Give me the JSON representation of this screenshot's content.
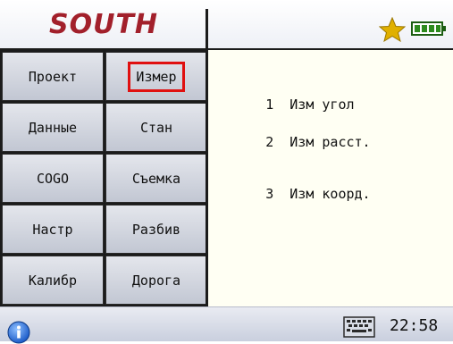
{
  "header": {
    "brand": "SOUTH",
    "icons": {
      "favorite": "star-icon",
      "battery": "battery-icon"
    },
    "colors": {
      "brand": "#a2202b",
      "star": "#e0b000",
      "battery": "#2d8a1e"
    }
  },
  "menu": {
    "items": [
      {
        "label": "Проект",
        "name": "menu-project"
      },
      {
        "label": "Измер",
        "name": "menu-measure",
        "selected": true
      },
      {
        "label": "Данные",
        "name": "menu-data"
      },
      {
        "label": "Стан",
        "name": "menu-station"
      },
      {
        "label": "COGO",
        "name": "menu-cogo"
      },
      {
        "label": "Съемка",
        "name": "menu-survey"
      },
      {
        "label": "Настр",
        "name": "menu-settings"
      },
      {
        "label": "Разбив",
        "name": "menu-stakeout"
      },
      {
        "label": "Калибр",
        "name": "menu-calibration"
      },
      {
        "label": "Дорога",
        "name": "menu-road"
      }
    ],
    "selected_color": "#e01010"
  },
  "submenu": {
    "items": [
      {
        "number": "1",
        "label": "Изм угол"
      },
      {
        "number": "2",
        "label": "Изм расст."
      },
      {
        "number": "3",
        "label": "Изм коорд."
      }
    ]
  },
  "statusbar": {
    "time": "22:58",
    "icons": {
      "info": "info-icon",
      "keyboard": "keyboard-icon"
    }
  }
}
